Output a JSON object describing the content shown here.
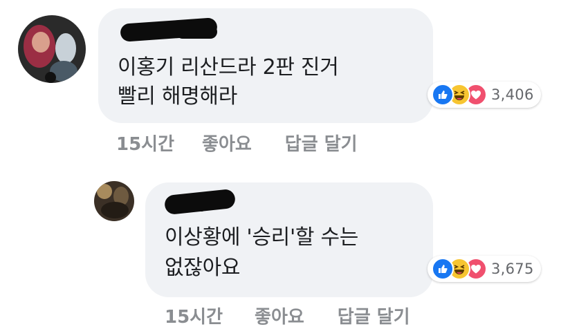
{
  "comments": [
    {
      "author_name": "",
      "text_lines": [
        "이홍기 리산드라 2판 진거",
        "빨리 해명해라"
      ],
      "reactions": {
        "icons": [
          "like-icon",
          "haha-icon",
          "love-icon"
        ],
        "count": "3,406"
      },
      "actions": {
        "time": "15시간",
        "like": "좋아요",
        "reply": "답글 달기"
      }
    },
    {
      "author_name": "",
      "text_lines": [
        "이상황에 '승리'할 수는",
        "없잖아요"
      ],
      "reactions": {
        "icons": [
          "like-icon",
          "haha-icon",
          "love-icon"
        ],
        "count": "3,675"
      },
      "actions": {
        "time": "15시간",
        "like": "좋아요",
        "reply": "답글 달기"
      }
    }
  ],
  "colors": {
    "bubble": "#f0f2f5",
    "text": "#1c1e21",
    "meta": "#8a8d91",
    "like": "#1877f2",
    "haha": "#f7c531",
    "love": "#f0506e"
  }
}
